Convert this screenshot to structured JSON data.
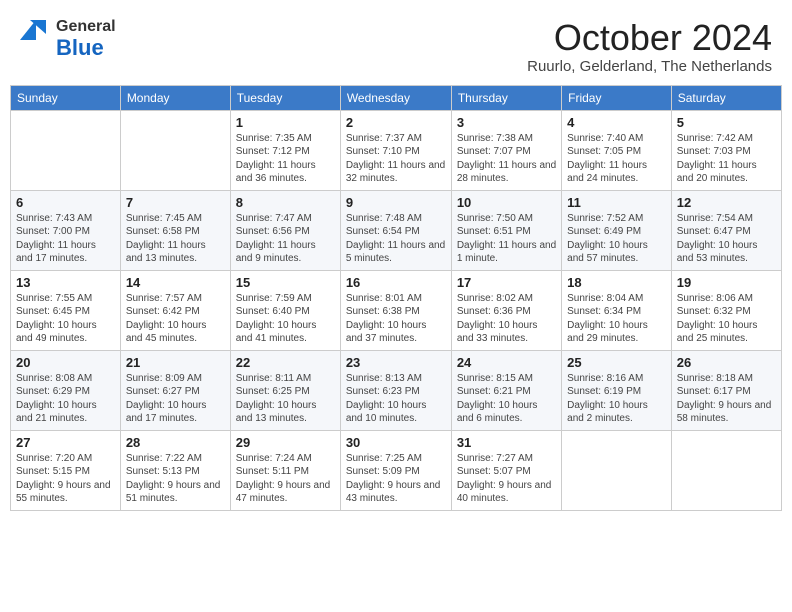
{
  "header": {
    "logo_line1": "General",
    "logo_line2": "Blue",
    "month_title": "October 2024",
    "location": "Ruurlo, Gelderland, The Netherlands"
  },
  "weekdays": [
    "Sunday",
    "Monday",
    "Tuesday",
    "Wednesday",
    "Thursday",
    "Friday",
    "Saturday"
  ],
  "weeks": [
    [
      {
        "day": "",
        "info": ""
      },
      {
        "day": "",
        "info": ""
      },
      {
        "day": "1",
        "info": "Sunrise: 7:35 AM\nSunset: 7:12 PM\nDaylight: 11 hours and 36 minutes."
      },
      {
        "day": "2",
        "info": "Sunrise: 7:37 AM\nSunset: 7:10 PM\nDaylight: 11 hours and 32 minutes."
      },
      {
        "day": "3",
        "info": "Sunrise: 7:38 AM\nSunset: 7:07 PM\nDaylight: 11 hours and 28 minutes."
      },
      {
        "day": "4",
        "info": "Sunrise: 7:40 AM\nSunset: 7:05 PM\nDaylight: 11 hours and 24 minutes."
      },
      {
        "day": "5",
        "info": "Sunrise: 7:42 AM\nSunset: 7:03 PM\nDaylight: 11 hours and 20 minutes."
      }
    ],
    [
      {
        "day": "6",
        "info": "Sunrise: 7:43 AM\nSunset: 7:00 PM\nDaylight: 11 hours and 17 minutes."
      },
      {
        "day": "7",
        "info": "Sunrise: 7:45 AM\nSunset: 6:58 PM\nDaylight: 11 hours and 13 minutes."
      },
      {
        "day": "8",
        "info": "Sunrise: 7:47 AM\nSunset: 6:56 PM\nDaylight: 11 hours and 9 minutes."
      },
      {
        "day": "9",
        "info": "Sunrise: 7:48 AM\nSunset: 6:54 PM\nDaylight: 11 hours and 5 minutes."
      },
      {
        "day": "10",
        "info": "Sunrise: 7:50 AM\nSunset: 6:51 PM\nDaylight: 11 hours and 1 minute."
      },
      {
        "day": "11",
        "info": "Sunrise: 7:52 AM\nSunset: 6:49 PM\nDaylight: 10 hours and 57 minutes."
      },
      {
        "day": "12",
        "info": "Sunrise: 7:54 AM\nSunset: 6:47 PM\nDaylight: 10 hours and 53 minutes."
      }
    ],
    [
      {
        "day": "13",
        "info": "Sunrise: 7:55 AM\nSunset: 6:45 PM\nDaylight: 10 hours and 49 minutes."
      },
      {
        "day": "14",
        "info": "Sunrise: 7:57 AM\nSunset: 6:42 PM\nDaylight: 10 hours and 45 minutes."
      },
      {
        "day": "15",
        "info": "Sunrise: 7:59 AM\nSunset: 6:40 PM\nDaylight: 10 hours and 41 minutes."
      },
      {
        "day": "16",
        "info": "Sunrise: 8:01 AM\nSunset: 6:38 PM\nDaylight: 10 hours and 37 minutes."
      },
      {
        "day": "17",
        "info": "Sunrise: 8:02 AM\nSunset: 6:36 PM\nDaylight: 10 hours and 33 minutes."
      },
      {
        "day": "18",
        "info": "Sunrise: 8:04 AM\nSunset: 6:34 PM\nDaylight: 10 hours and 29 minutes."
      },
      {
        "day": "19",
        "info": "Sunrise: 8:06 AM\nSunset: 6:32 PM\nDaylight: 10 hours and 25 minutes."
      }
    ],
    [
      {
        "day": "20",
        "info": "Sunrise: 8:08 AM\nSunset: 6:29 PM\nDaylight: 10 hours and 21 minutes."
      },
      {
        "day": "21",
        "info": "Sunrise: 8:09 AM\nSunset: 6:27 PM\nDaylight: 10 hours and 17 minutes."
      },
      {
        "day": "22",
        "info": "Sunrise: 8:11 AM\nSunset: 6:25 PM\nDaylight: 10 hours and 13 minutes."
      },
      {
        "day": "23",
        "info": "Sunrise: 8:13 AM\nSunset: 6:23 PM\nDaylight: 10 hours and 10 minutes."
      },
      {
        "day": "24",
        "info": "Sunrise: 8:15 AM\nSunset: 6:21 PM\nDaylight: 10 hours and 6 minutes."
      },
      {
        "day": "25",
        "info": "Sunrise: 8:16 AM\nSunset: 6:19 PM\nDaylight: 10 hours and 2 minutes."
      },
      {
        "day": "26",
        "info": "Sunrise: 8:18 AM\nSunset: 6:17 PM\nDaylight: 9 hours and 58 minutes."
      }
    ],
    [
      {
        "day": "27",
        "info": "Sunrise: 7:20 AM\nSunset: 5:15 PM\nDaylight: 9 hours and 55 minutes."
      },
      {
        "day": "28",
        "info": "Sunrise: 7:22 AM\nSunset: 5:13 PM\nDaylight: 9 hours and 51 minutes."
      },
      {
        "day": "29",
        "info": "Sunrise: 7:24 AM\nSunset: 5:11 PM\nDaylight: 9 hours and 47 minutes."
      },
      {
        "day": "30",
        "info": "Sunrise: 7:25 AM\nSunset: 5:09 PM\nDaylight: 9 hours and 43 minutes."
      },
      {
        "day": "31",
        "info": "Sunrise: 7:27 AM\nSunset: 5:07 PM\nDaylight: 9 hours and 40 minutes."
      },
      {
        "day": "",
        "info": ""
      },
      {
        "day": "",
        "info": ""
      }
    ]
  ]
}
